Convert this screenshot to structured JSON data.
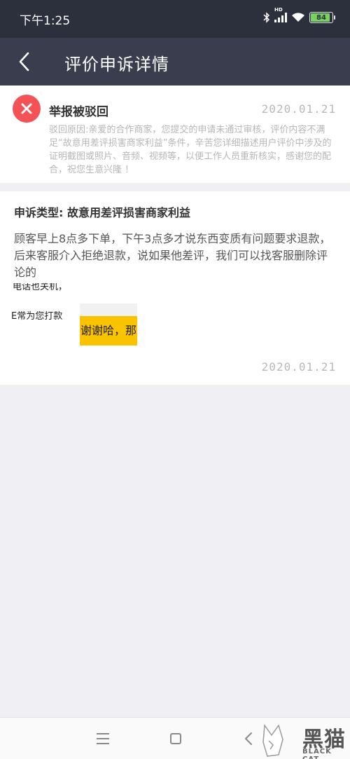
{
  "status_bar": {
    "time": "下午1:25",
    "signal_badge": "HD",
    "battery": "84"
  },
  "header": {
    "title": "评价申诉详情",
    "back_icon": "chevron-left-icon"
  },
  "result_card": {
    "icon": "close-circle-icon",
    "status": "举报被驳回",
    "date": "2020.01.21",
    "reason": "驳回原因:亲爱的合作商家，您提交的申请未通过审核，评价内容不满足“故意用差评损害商家利益”条件，辛苦您详细描述用户评价中涉及的证明截图或照片、音频、视频等，以便工作人员重新核实，感谢您的配合，祝您生意兴隆 ！"
  },
  "appeal_card": {
    "type_label": "申诉类型: 故意用差评损害商家利益",
    "description": "顾客早上8点多下单，下午3点多才说东西变质有问题要求退款，后来客服介入拒绝退款，说如果他差评，我们可以找客服删除评论的",
    "attachment_fragment_1": "电话也关机，",
    "attachment_fragment_2": "E常为您打款",
    "attachment_fragment_3": "谢谢哈，那",
    "date": "2020.01.21"
  },
  "nav_bar": {
    "menu_icon": "menu-icon",
    "home_icon": "home-square-icon",
    "back_icon": "back-triangle-icon"
  },
  "watermark": {
    "brand": "黑猫",
    "sub": "BLACK CAT"
  },
  "colors": {
    "status_bar_bg": "#2c2f3c",
    "header_bg": "#393d4e",
    "reject_red": "#f35357",
    "highlight_yellow": "#f9c300",
    "page_bg": "#efeff4"
  }
}
